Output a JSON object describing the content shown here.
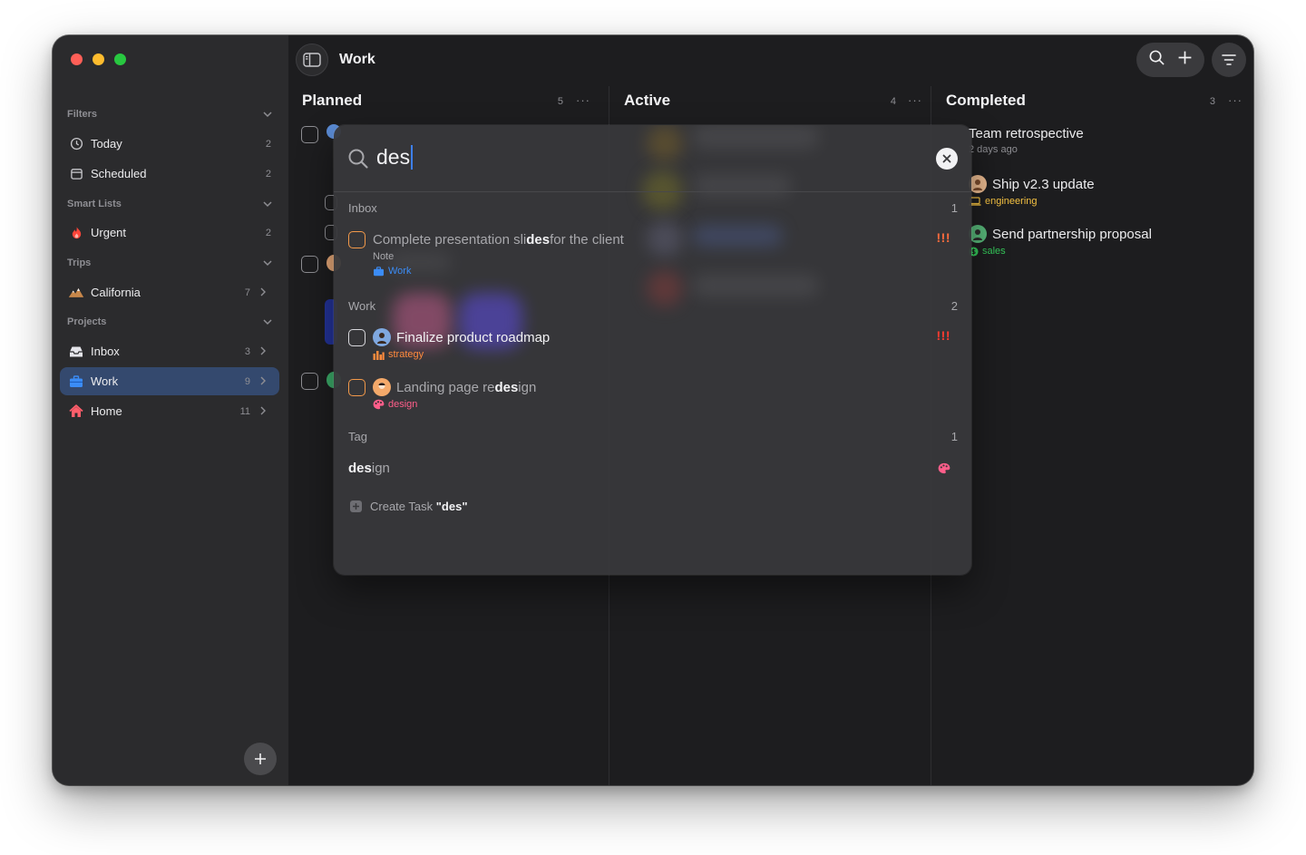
{
  "colors": {
    "window_bg": "#1d1d1f",
    "sidebar_bg": "#2b2b2d",
    "selected": "#34496e",
    "accent": "#3d7ff0",
    "urgent": "#ff3b30",
    "engineering": "#f5c242",
    "sales": "#34c759",
    "design": "#ff5e8a",
    "strategy": "#ff8a3d"
  },
  "sidebar": {
    "filters_label": "Filters",
    "filters": [
      {
        "label": "Today",
        "count": "2",
        "icon": "clock-icon"
      },
      {
        "label": "Scheduled",
        "count": "2",
        "icon": "calendar-icon"
      }
    ],
    "smart_lists_label": "Smart Lists",
    "smart_lists": [
      {
        "label": "Urgent",
        "count": "2",
        "icon": "fire-icon"
      }
    ],
    "trips_label": "Trips",
    "trips": [
      {
        "label": "California",
        "count": "7",
        "icon": "mountain-icon"
      }
    ],
    "projects_label": "Projects",
    "projects": [
      {
        "label": "Inbox",
        "count": "3",
        "icon": "inbox-icon"
      },
      {
        "label": "Work",
        "count": "9",
        "icon": "briefcase-icon",
        "selected": true
      },
      {
        "label": "Home",
        "count": "11",
        "icon": "house-icon"
      }
    ]
  },
  "header": {
    "title": "Work"
  },
  "columns": {
    "planned": {
      "title": "Planned",
      "count": "5"
    },
    "active": {
      "title": "Active",
      "count": "4"
    },
    "completed": {
      "title": "Completed",
      "count": "3",
      "items": [
        {
          "title": "Team retrospective",
          "sub": "2 days ago"
        },
        {
          "title": "Ship v2.3 update",
          "tag": "engineering"
        },
        {
          "title": "Send partnership proposal",
          "tag": "sales"
        }
      ]
    }
  },
  "search": {
    "query": "des",
    "groups": {
      "inbox": {
        "label": "Inbox",
        "count": "1"
      },
      "work": {
        "label": "Work",
        "count": "2"
      },
      "tag": {
        "label": "Tag",
        "count": "1"
      }
    },
    "results": {
      "r1": {
        "pre": "Complete presentation sli",
        "match": "des",
        "post": " for the client",
        "note": "Note",
        "project": "Work",
        "priority": "!!!"
      },
      "r2": {
        "title": "Finalize product roadmap",
        "tag": "strategy",
        "priority": "!!!"
      },
      "r3": {
        "pre": "Landing page re",
        "match": "des",
        "post": "ign",
        "tag": "design"
      }
    },
    "tag_result": {
      "match": "des",
      "post": "ign"
    },
    "create": {
      "prefix": "Create Task",
      "quoted": "\"des\""
    }
  }
}
